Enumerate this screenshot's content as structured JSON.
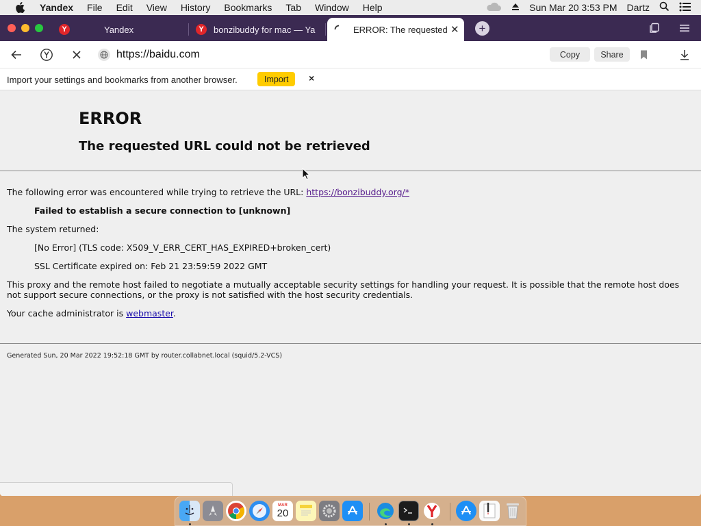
{
  "menubar": {
    "app_name": "Yandex",
    "items": [
      "File",
      "Edit",
      "View",
      "History",
      "Bookmarks",
      "Tab",
      "Window",
      "Help"
    ],
    "clock": "Sun Mar 20  3:53 PM",
    "user": "Dartz"
  },
  "tabs": [
    {
      "title": "Yandex",
      "active": false
    },
    {
      "title": "bonzibuddy for mac — Ya",
      "active": false
    },
    {
      "title": "ERROR: The requested",
      "active": true
    }
  ],
  "toolbar": {
    "url": "https://baidu.com",
    "copy_label": "Copy",
    "share_label": "Share"
  },
  "import_bar": {
    "message": "Import your settings and bookmarks from another browser.",
    "button_label": "Import",
    "close_label": "×"
  },
  "error_page": {
    "title": "ERROR",
    "subtitle": "The requested URL could not be retrieved",
    "intro": "The following error was encountered while trying to retrieve the URL: ",
    "intro_link": "https://bonzibuddy.org/*",
    "failure": "Failed to establish a secure connection to [unknown]",
    "system_returned": "The system returned:",
    "tls_code": "[No Error] (TLS code: X509_V_ERR_CERT_HAS_EXPIRED+broken_cert)",
    "cert_expired": "SSL Certificate expired on: Feb 21 23:59:59 2022 GMT",
    "proxy_message": "This proxy and the remote host failed to negotiate a mutually acceptable security settings for handling your request. It is possible that the remote host does not support secure connections, or the proxy is not satisfied with the host security credentials.",
    "admin_prefix": "Your cache administrator is ",
    "admin_link": "webmaster",
    "admin_suffix": ".",
    "footer": "Generated Sun, 20 Mar 2022 19:52:18 GMT by router.collabnet.local (squid/5.2-VCS)"
  },
  "dock": {
    "calendar_month": "MAR",
    "calendar_day": "20",
    "apps": [
      "finder-icon",
      "launchpad-icon",
      "chrome-icon",
      "safari-icon",
      "calendar-icon",
      "notes-icon",
      "system-preferences-icon",
      "app-store-icon",
      "edge-icon",
      "terminal-icon",
      "yandex-icon",
      "app-store-icon",
      "textedit-icon",
      "trash-icon"
    ]
  },
  "colors": {
    "tabstrip": "#3b2a52",
    "import_button": "#ffcc00",
    "link": "#551a8b"
  }
}
